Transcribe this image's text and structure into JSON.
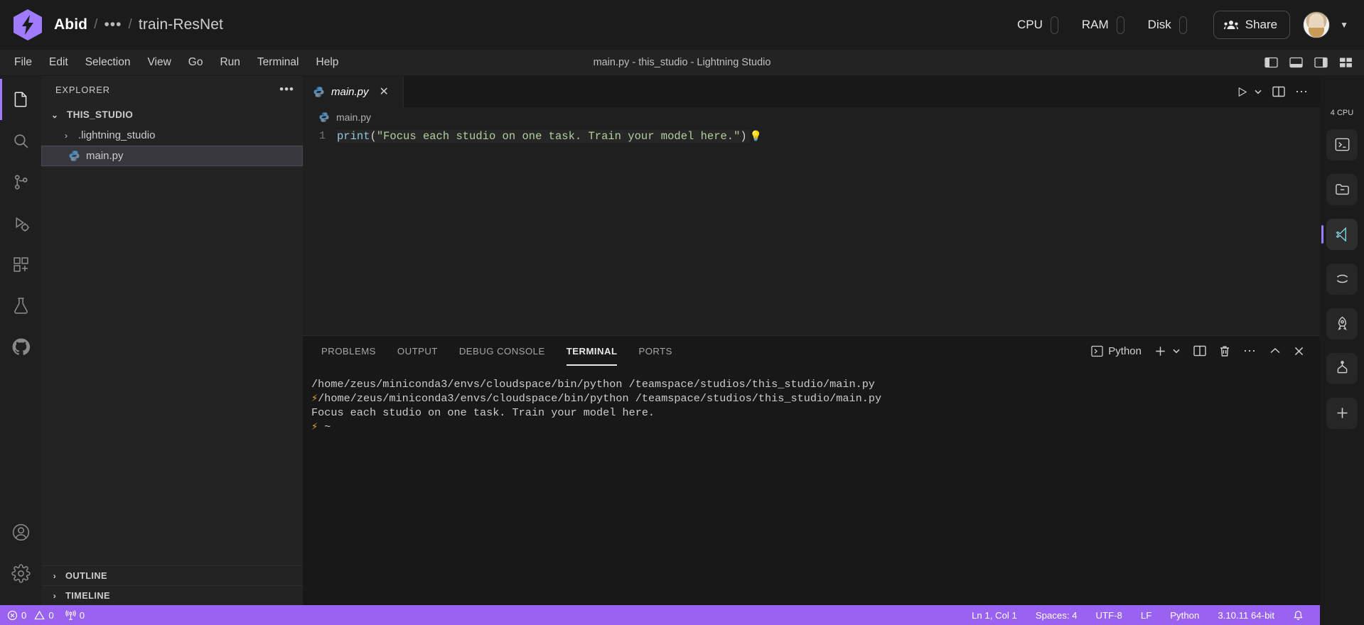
{
  "lightning_header": {
    "logo_icon": "lightning-hex-logo",
    "breadcrumb": {
      "owner": "Abid",
      "separator": "/",
      "ellipsis": "•••",
      "project": "train-ResNet"
    },
    "meters": [
      {
        "label": "CPU",
        "icon": "capsule-gauge-icon"
      },
      {
        "label": "RAM",
        "icon": "capsule-gauge-icon"
      },
      {
        "label": "Disk",
        "icon": "capsule-gauge-icon"
      }
    ],
    "share_label": "Share",
    "share_icon": "people-group-icon",
    "avatar_icon": "user-avatar",
    "caret_icon": "chevron-down-icon"
  },
  "titlebar": {
    "menus": [
      "File",
      "Edit",
      "Selection",
      "View",
      "Go",
      "Run",
      "Terminal",
      "Help"
    ],
    "window_title": "main.py - this_studio - Lightning Studio",
    "layout_icons": [
      "toggle-primary-sidebar-icon",
      "toggle-panel-icon",
      "toggle-secondary-sidebar-icon",
      "customize-layout-icon"
    ]
  },
  "activitybar": {
    "items": [
      {
        "name": "explorer",
        "icon": "files-icon",
        "active": true
      },
      {
        "name": "search",
        "icon": "search-icon",
        "active": false
      },
      {
        "name": "source-control",
        "icon": "source-control-icon",
        "active": false
      },
      {
        "name": "run-and-debug",
        "icon": "run-debug-icon",
        "active": false
      },
      {
        "name": "extensions",
        "icon": "extensions-icon",
        "active": false
      },
      {
        "name": "testing",
        "icon": "beaker-icon",
        "active": false
      },
      {
        "name": "github",
        "icon": "github-icon",
        "active": false
      },
      {
        "name": "accounts",
        "icon": "account-icon",
        "active": false
      },
      {
        "name": "manage",
        "icon": "gear-icon",
        "active": false
      }
    ]
  },
  "sidebar": {
    "title": "EXPLORER",
    "more_icon": "ellipsis-icon",
    "tree": [
      {
        "label": "THIS_STUDIO",
        "type": "root",
        "expanded": true,
        "chevron": "chevron-down"
      },
      {
        "label": ".lightning_studio",
        "type": "folder",
        "expanded": false,
        "chevron": "chevron-right"
      },
      {
        "label": "main.py",
        "type": "file-python",
        "selected": true
      }
    ],
    "sections": [
      {
        "label": "OUTLINE",
        "chevron": "chevron-right"
      },
      {
        "label": "TIMELINE",
        "chevron": "chevron-right"
      }
    ]
  },
  "editor": {
    "tabs": [
      {
        "label": "main.py",
        "icon": "python-file-icon",
        "active": true,
        "close_icon": "close-icon"
      }
    ],
    "tab_actions": [
      "run-python-file-icon",
      "run-chevron-icon",
      "split-editor-icon",
      "more-actions-icon"
    ],
    "breadcrumb": {
      "icon": "python-file-icon",
      "label": "main.py"
    },
    "code": {
      "line_number": "1",
      "tokens": {
        "fn": "print",
        "open_paren": "(",
        "string": "\"Focus each studio on one task. Train your model here.\"",
        "close_paren": ")"
      },
      "lightbulb_icon": "💡"
    }
  },
  "panel": {
    "tabs": [
      {
        "label": "PROBLEMS",
        "active": false
      },
      {
        "label": "OUTPUT",
        "active": false
      },
      {
        "label": "DEBUG CONSOLE",
        "active": false
      },
      {
        "label": "TERMINAL",
        "active": true
      },
      {
        "label": "PORTS",
        "active": false
      }
    ],
    "shell_label": "Python",
    "shell_icon": "terminal-chevron-icon",
    "actions": [
      "new-terminal-icon",
      "terminal-profile-chevron-icon",
      "split-terminal-icon",
      "kill-terminal-icon",
      "views-and-more-icon",
      "maximize-panel-icon",
      "close-panel-icon"
    ],
    "terminal_lines": [
      {
        "prefix": "",
        "text": "/home/zeus/miniconda3/envs/cloudspace/bin/python /teamspace/studios/this_studio/main.py"
      },
      {
        "prefix": "⚡ ~ ",
        "text": "/home/zeus/miniconda3/envs/cloudspace/bin/python /teamspace/studios/this_studio/main.py"
      },
      {
        "prefix": "",
        "text": "Focus each studio on one task. Train your model here."
      },
      {
        "prefix": "⚡ ~",
        "text": ""
      }
    ]
  },
  "rightrail": {
    "cpu_label": "4 CPU",
    "items": [
      {
        "name": "terminal",
        "icon": "terminal-icon",
        "selected": false
      },
      {
        "name": "file-browser",
        "icon": "folder-icon",
        "selected": false
      },
      {
        "name": "vscode",
        "icon": "vscode-icon",
        "selected": true
      },
      {
        "name": "jupyter",
        "icon": "jupyter-icon",
        "selected": false
      },
      {
        "name": "deploy",
        "icon": "rocket-icon",
        "selected": false
      },
      {
        "name": "model-api",
        "icon": "network-icon",
        "selected": false
      },
      {
        "name": "add-plugin",
        "icon": "plus-icon",
        "selected": false
      }
    ]
  },
  "statusbar": {
    "errors_icon": "error-circle-icon",
    "errors": "0",
    "warnings_icon": "warning-triangle-icon",
    "warnings": "0",
    "ports_icon": "radio-tower-icon",
    "ports": "0",
    "right_items": [
      "Ln 1, Col 1",
      "Spaces: 4",
      "UTF-8",
      "LF",
      "Python",
      "3.10.11 64-bit"
    ],
    "bell_icon": "bell-icon"
  }
}
